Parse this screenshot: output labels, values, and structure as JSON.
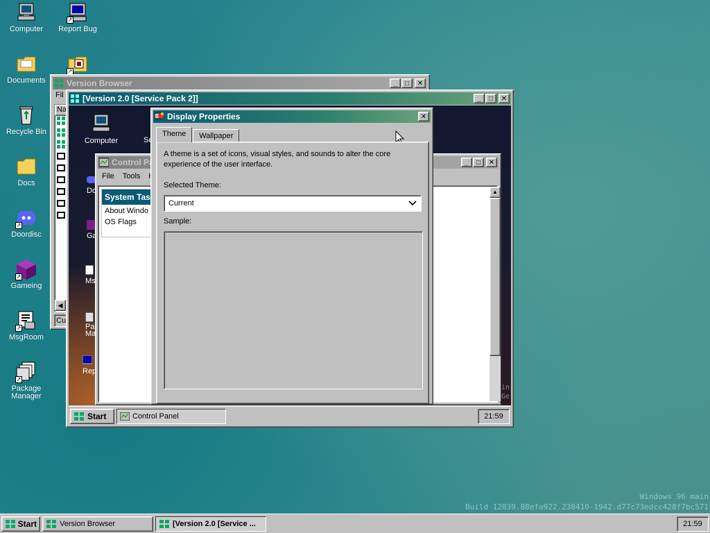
{
  "desktop": {
    "icons": [
      {
        "label": "Computer",
        "icon": "computer-icon"
      },
      {
        "label": "Report Bug",
        "icon": "report-bug-icon"
      },
      {
        "label": "Documents",
        "icon": "documents-folder-icon"
      },
      {
        "label": "Recycle Bin",
        "icon": "recycle-bin-icon"
      },
      {
        "label": "Docs",
        "icon": "folder-icon"
      },
      {
        "label": "Doordisc",
        "icon": "discord-icon"
      },
      {
        "label": "Gameing",
        "icon": "purple-cube-icon"
      },
      {
        "label": "MsgRoom",
        "icon": "msgroom-icon"
      },
      {
        "label": "Package Manager",
        "icon": "package-manager-icon"
      }
    ],
    "watermark": {
      "line1": "Windows 96 main",
      "line2": "Build 12839.88efa922.230410-1942.d77c73edcc428f7bc571"
    }
  },
  "version_browser": {
    "title": "Version Browser",
    "menu_stub": "Fil",
    "header_stub": "Na",
    "status_stub": "Cur"
  },
  "version_window": {
    "title": "[Version 2.0 [Service Pack 2]]",
    "inner_icons": [
      {
        "label": "Computer",
        "icon": "computer-icon"
      },
      {
        "label": "Se",
        "icon": "settings-icon"
      },
      {
        "label": "Do",
        "icon": "discord-icon"
      },
      {
        "label": "Ga",
        "icon": "purple-cube-icon"
      },
      {
        "label": "Msg",
        "icon": "msgroom-icon"
      },
      {
        "label": "Pac Man",
        "icon": "package-manager-icon"
      },
      {
        "label": "Rep",
        "icon": "report-bug-icon"
      }
    ],
    "taskbar": {
      "start_label": "Start",
      "task_label": "Control Panel",
      "clock": "21:59"
    },
    "right_fragment": [
      "in",
      "Ge"
    ]
  },
  "control_panel": {
    "title": "Control Pa",
    "menu": [
      "File",
      "Tools",
      "H"
    ],
    "system_tasks_title": "System Tas",
    "items": [
      "About Windo",
      "OS Flags"
    ]
  },
  "display_properties": {
    "title": "Display Properties",
    "tabs": [
      "Theme",
      "Wallpaper"
    ],
    "active_tab": "Theme",
    "description": "A theme is a set of icons, visual styles, and sounds to alter the core experience of the user interface.",
    "selected_theme_label": "Selected Theme:",
    "selected_theme_value": "Current",
    "sample_label": "Sample:"
  },
  "taskbar": {
    "start_label": "Start",
    "tasks": [
      {
        "label": "Version Browser",
        "active": false
      },
      {
        "label": "[Version 2.0 [Service ...",
        "active": true
      }
    ],
    "clock": "21:59"
  },
  "colors": {
    "desktop": "#2f8a90",
    "title_active_start": "#0b5a73",
    "title_active_end": "#6ea37a",
    "face": "#c0c0c0"
  }
}
